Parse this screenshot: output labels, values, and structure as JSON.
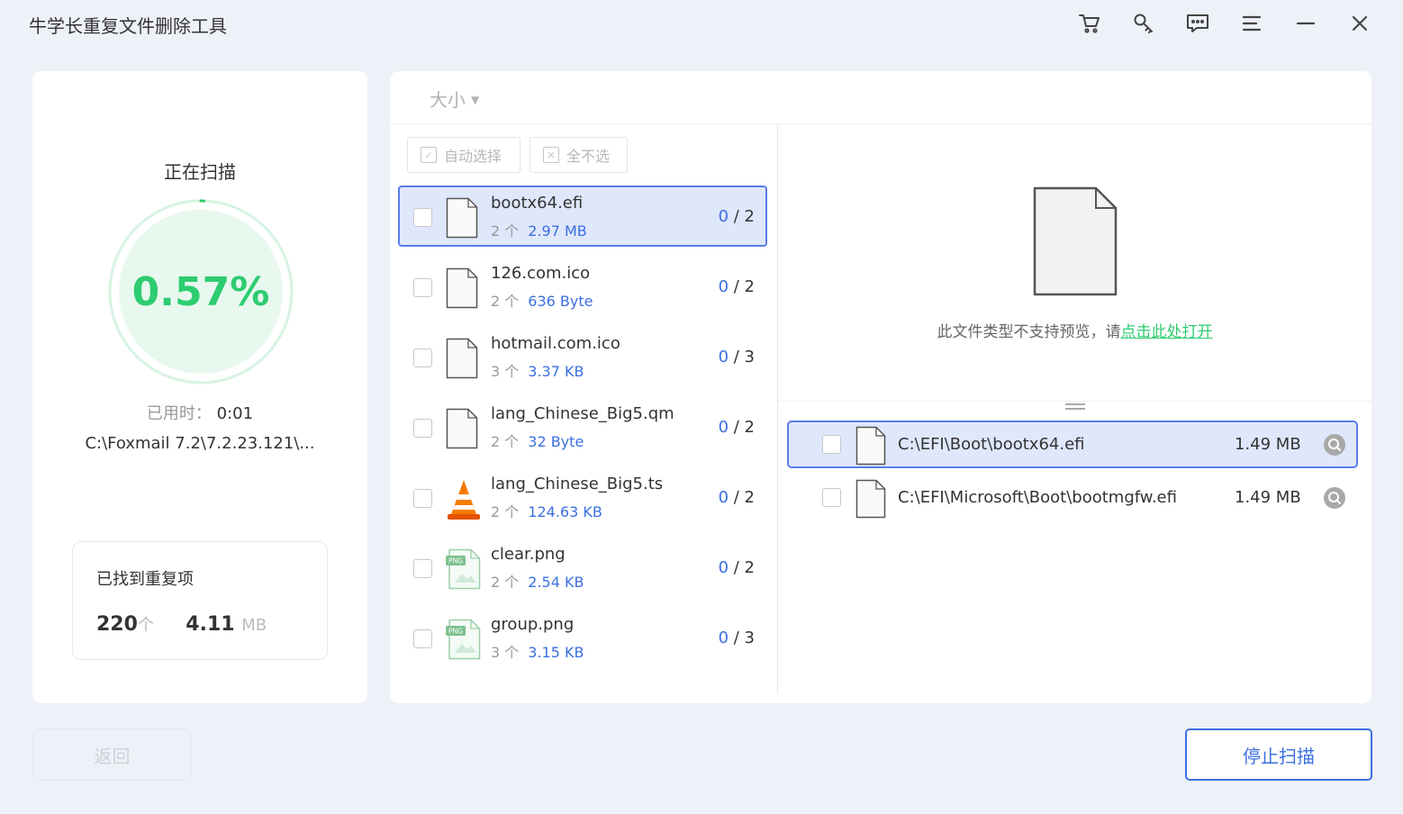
{
  "app": {
    "title": "牛学长重复文件删除工具"
  },
  "toolbar": {
    "icons": [
      "cart-icon",
      "key-icon",
      "feedback-icon",
      "menu-icon",
      "minimize-icon",
      "close-icon"
    ]
  },
  "scan": {
    "title": "正在扫描",
    "percent": "0.57%",
    "progress_fraction": 0.0057,
    "elapsed_label": "已用时：",
    "elapsed_value": "0:01",
    "current_path": "C:\\Foxmail 7.2\\7.2.23.121\\..."
  },
  "found": {
    "label": "已找到重复项",
    "count": "220",
    "count_unit": "个",
    "size": "4.11",
    "size_unit": "MB"
  },
  "sort": {
    "label": "大小",
    "caret": "▼"
  },
  "tools": {
    "auto_select": "自动选择",
    "select_none": "全不选"
  },
  "files": [
    {
      "name": "bootx64.efi",
      "count": "2 个",
      "size": "2.97 MB",
      "selected": "0",
      "total": "/ 2",
      "icon": "file-icon"
    },
    {
      "name": "126.com.ico",
      "count": "2 个",
      "size": "636 Byte",
      "selected": "0",
      "total": "/ 2",
      "icon": "file-icon"
    },
    {
      "name": "hotmail.com.ico",
      "count": "3 个",
      "size": "3.37 KB",
      "selected": "0",
      "total": "/ 3",
      "icon": "file-icon"
    },
    {
      "name": "lang_Chinese_Big5.qm",
      "count": "2 个",
      "size": "32 Byte",
      "selected": "0",
      "total": "/ 2",
      "icon": "file-icon"
    },
    {
      "name": "lang_Chinese_Big5.ts",
      "count": "2 个",
      "size": "124.63 KB",
      "selected": "0",
      "total": "/ 2",
      "icon": "vlc-icon"
    },
    {
      "name": "clear.png",
      "count": "2 个",
      "size": "2.54 KB",
      "selected": "0",
      "total": "/ 2",
      "icon": "png-icon"
    },
    {
      "name": "group.png",
      "count": "3 个",
      "size": "3.15 KB",
      "selected": "0",
      "total": "/ 3",
      "icon": "png-icon"
    }
  ],
  "preview": {
    "message": "此文件类型不支持预览，请",
    "link": "点击此处打开"
  },
  "duplicates": [
    {
      "path": "C:\\EFI\\Boot\\bootx64.efi",
      "size": "1.49 MB"
    },
    {
      "path": "C:\\EFI\\Microsoft\\Boot\\bootmgfw.efi",
      "size": "1.49 MB"
    }
  ],
  "footer": {
    "back": "返回",
    "stop": "停止扫描"
  },
  "colors": {
    "accent": "#3b6fe0",
    "green": "#2ecc71",
    "background": "#eef1f7"
  }
}
